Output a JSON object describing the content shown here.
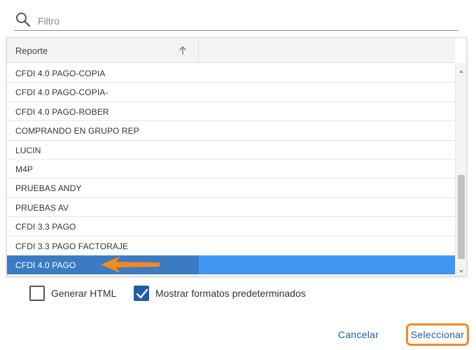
{
  "search": {
    "placeholder": "Filtro"
  },
  "grid": {
    "column_header": "Reporte",
    "rows": [
      "CFDI 4.0 PAGO-COPIA",
      "CFDI 4.0 PAGO-COPIA-",
      "CFDI 4.0 PAGO-ROBER",
      "COMPRANDO EN GRUPO REP",
      "LUCIN",
      "M4P",
      "PRUEBAS ANDY",
      "PRUEBAS AV",
      "CFDI 3.3 PAGO",
      "CFDI 3.3 PAGO FACTORAJE",
      "CFDI 4.0 PAGO"
    ],
    "selected_index": 10,
    "sort": "ascending"
  },
  "options": {
    "generate_html_label": "Generar HTML",
    "generate_html_checked": false,
    "show_default_formats_label": "Mostrar formatos predeterminados",
    "show_default_formats_checked": true
  },
  "buttons": {
    "cancel_label": "Cancelar",
    "select_label": "Seleccionar"
  },
  "colors": {
    "accent": "#1e5ea8",
    "selected_row": "#3f96f5",
    "selected_cell": "#3b7bc4",
    "highlight": "#f28a1e"
  },
  "icons": [
    "search-icon",
    "sort-ascending-icon",
    "scroll-up-icon",
    "scroll-down-icon",
    "checkmark-icon",
    "annotation-arrow-icon"
  ]
}
